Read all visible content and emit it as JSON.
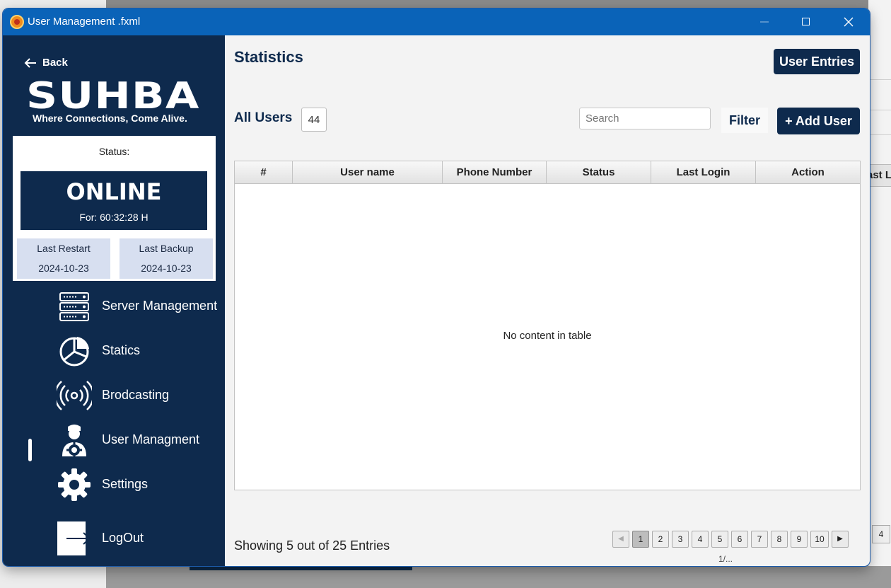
{
  "window": {
    "title": "User Management .fxml"
  },
  "background": {
    "frag_text": "ast L",
    "frag_page": "4"
  },
  "sidebar": {
    "back_label": "Back",
    "logo": "SUHBA",
    "tagline": "Where Connections, Come Alive.",
    "status": {
      "label": "Status:",
      "state": "ONLINE",
      "duration": "For: 60:32:28 H",
      "last_restart_label": "Last Restart",
      "last_restart": "2024-10-23",
      "last_backup_label": "Last Backup",
      "last_backup": "2024-10-23"
    },
    "nav": [
      {
        "label": "Server Management",
        "icon": "server-icon"
      },
      {
        "label": "Statics",
        "icon": "pie-chart-icon"
      },
      {
        "label": "Brodcasting",
        "icon": "broadcast-icon"
      },
      {
        "label": "User Managment",
        "icon": "user-gear-icon",
        "active": true
      },
      {
        "label": "Settings",
        "icon": "gear-icon"
      },
      {
        "label": "LogOut",
        "icon": "logout-icon"
      }
    ]
  },
  "main": {
    "title": "Statistics",
    "user_entries_label": "User Entries",
    "all_users_label": "All Users",
    "user_count": "44",
    "search_placeholder": "Search",
    "filter_label": "Filter",
    "add_user_label": "+ Add User",
    "table": {
      "columns": [
        "#",
        "User name",
        "Phone Number",
        "Status",
        "Last Login",
        "Action"
      ],
      "empty_message": "No content in table"
    },
    "showing_text": "Showing 5 out of 25 Entries",
    "pagination": {
      "pages": [
        "1",
        "2",
        "3",
        "4",
        "5",
        "6",
        "7",
        "8",
        "9",
        "10"
      ],
      "current": "1",
      "info": "1/..."
    }
  }
}
